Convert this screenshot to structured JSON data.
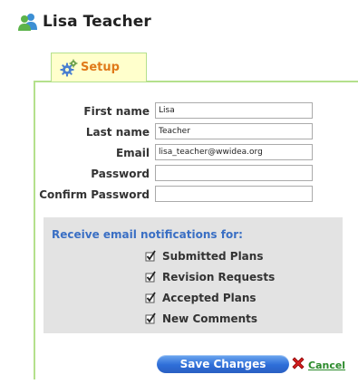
{
  "header": {
    "title": "Lisa Teacher",
    "icon": "users-icon"
  },
  "tab": {
    "label": "Setup",
    "icon": "gear-icon",
    "background": "#ffffcc",
    "label_color": "#e07a1a",
    "border_color": "#b4e08c"
  },
  "form": {
    "first_name": {
      "label": "First name",
      "value": "Lisa"
    },
    "last_name": {
      "label": "Last name",
      "value": "Teacher"
    },
    "email": {
      "label": "Email",
      "value": "lisa_teacher@wwidea.org"
    },
    "password": {
      "label": "Password",
      "value": ""
    },
    "confirm_password": {
      "label": "Confirm Password",
      "value": ""
    }
  },
  "notifications": {
    "heading": "Receive email notifications for:",
    "heading_color": "#3a6fc4",
    "options": [
      {
        "label": "Submitted Plans",
        "checked": true
      },
      {
        "label": "Revision Requests",
        "checked": true
      },
      {
        "label": "Accepted Plans",
        "checked": true
      },
      {
        "label": "New Comments",
        "checked": true
      }
    ]
  },
  "actions": {
    "save_label": "Save Changes",
    "cancel_label": "Cancel",
    "cancel_icon": "x-icon",
    "save_color": "#2e6ed8",
    "cancel_color": "#2a8a2a"
  }
}
